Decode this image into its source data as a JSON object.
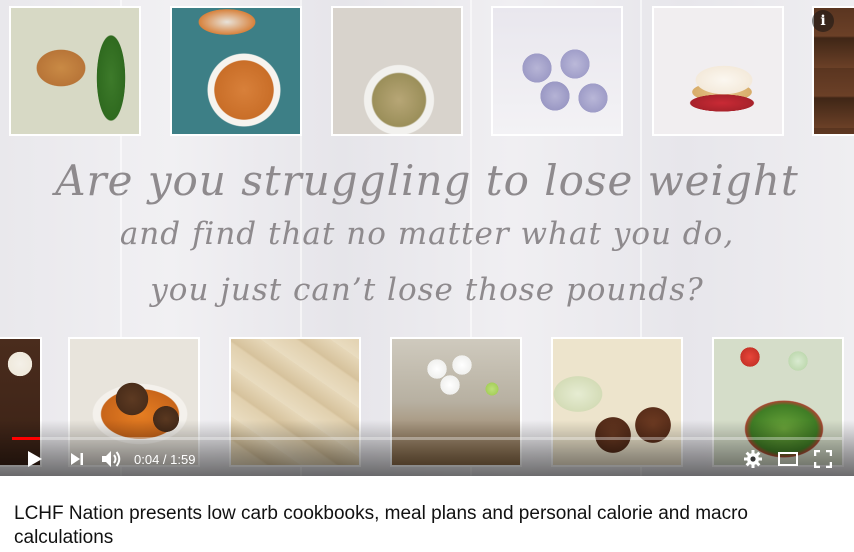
{
  "player": {
    "headline": {
      "line1": "Are you struggling to lose weight",
      "line2": "and find that no matter what you do,",
      "line3": "you just can’t lose those pounds?"
    },
    "info_label": "i",
    "controls": {
      "time_display": "0:04 / 1:59",
      "progress": 0.034,
      "progress_color": "#ff0000"
    },
    "food_tiles": [
      "chicken-with-green-beans",
      "pumpkin-custard-ramekins",
      "meatball-soup-bowl",
      "blueberry-fat-bombs",
      "strawberry-shortcake",
      "brownie-stack",
      "chocolate-cake-slice",
      "meatballs-with-carrots",
      "pizza-slices",
      "coconut-balls-in-glass",
      "falafel-patties",
      "taco-salad"
    ]
  },
  "video": {
    "title": "LCHF Nation presents low carb cookbooks, meal plans and personal calorie and macro calculations"
  }
}
